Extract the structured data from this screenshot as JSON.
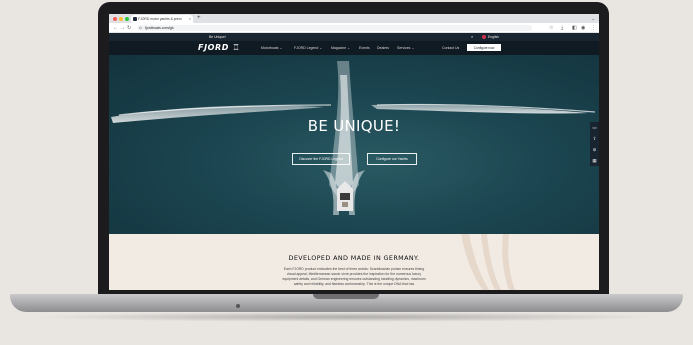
{
  "browser": {
    "tab_title": "FJORD motor yachts & prem",
    "tab_close": "×",
    "tab_new": "+",
    "tab_menu": "⌄",
    "url": "fjordboats.com/gb",
    "nav_back": "←",
    "nav_forward": "→",
    "nav_reload": "↻",
    "icons": [
      "star-icon",
      "download-icon",
      "extensions-icon",
      "profile-icon",
      "menu-icon"
    ]
  },
  "site": {
    "tagline": "Be Unique!",
    "language": "English",
    "logo": "FJORD",
    "nav": [
      {
        "label": "Motorboats ⌄"
      },
      {
        "label": "FJORD Legend ⌄"
      },
      {
        "label": "Magazine ⌄"
      },
      {
        "label": "Events"
      },
      {
        "label": "Dealers"
      },
      {
        "label": "Services ⌄"
      }
    ],
    "contact": "Contact Us",
    "configure": "Configure now"
  },
  "hero": {
    "title": "BE UNIQUE!",
    "primary_cta": "Discover the FJORD Legend",
    "secondary_cta": "Configure our Yachts",
    "side_icons": [
      "chat-icon",
      "share-icon",
      "location-icon",
      "calendar-icon"
    ]
  },
  "section": {
    "title": "DEVELOPED AND MADE IN GERMANY.",
    "body": "Each FJORD product embodies the best of three worlds: Scandinavian purism ensures timing visual appeal, Mediterranean savoir-vivre provides the inspiration for the numerous luxury equipment details, and German engineering ensures outstanding handling dynamics, maximum safety and reliability, and flawless workmanship. This is the unique DNA that has"
  },
  "colors": {
    "topbar": "#182530",
    "nav": "#101a22",
    "sea": "#1b4550",
    "section_bg": "#f2ebe4"
  }
}
